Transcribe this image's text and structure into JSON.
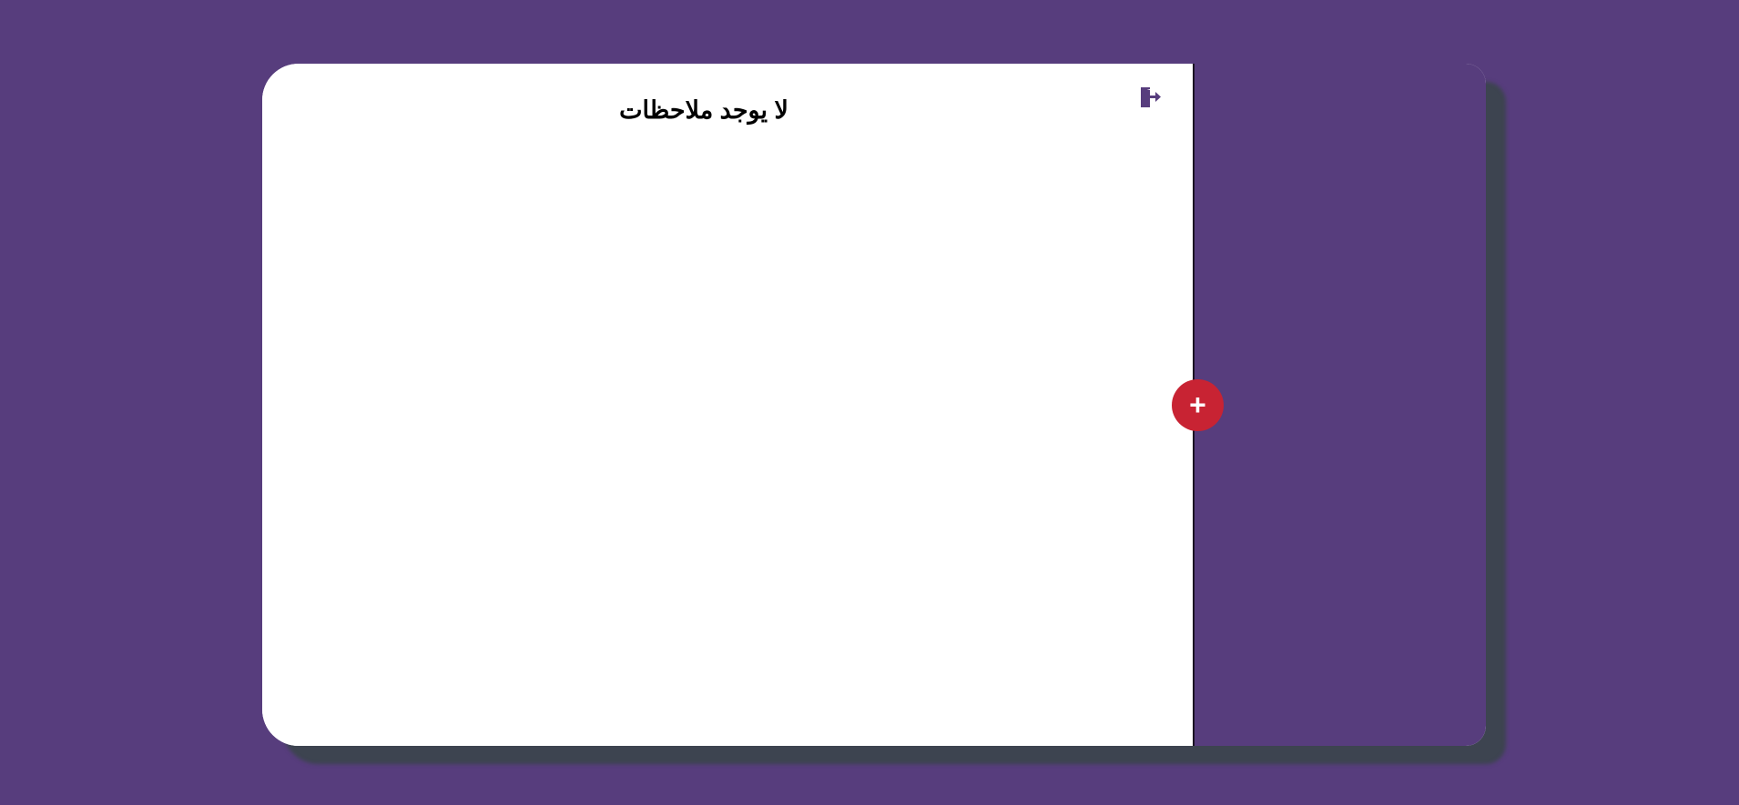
{
  "notes": {
    "empty_message": "لا يوجد ملاحظات"
  },
  "header": {
    "logout_icon": "logout-door-icon"
  },
  "actions": {
    "add_label": "+"
  },
  "colors": {
    "background": "#573d7d",
    "panel": "#ffffff",
    "accent": "#c82333",
    "shadow": "#3d4450",
    "icon": "#573d7d"
  }
}
